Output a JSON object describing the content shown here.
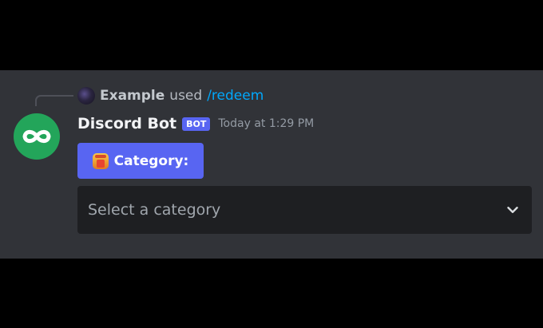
{
  "reply": {
    "username": "Example",
    "used_text": "used",
    "command": "/redeem"
  },
  "message": {
    "author": "Discord Bot",
    "bot_tag": "BOT",
    "timestamp": "Today at 1:29 PM"
  },
  "button": {
    "label": "Category:",
    "icon": "box-emoji-icon"
  },
  "select": {
    "placeholder": "Select a category",
    "icon": "chevron-down-icon"
  },
  "colors": {
    "panel": "#313338",
    "blurple": "#5865f2",
    "avatar_green": "#23a55a",
    "link_blue": "#00a8fc",
    "select_bg": "#1e1f22"
  }
}
